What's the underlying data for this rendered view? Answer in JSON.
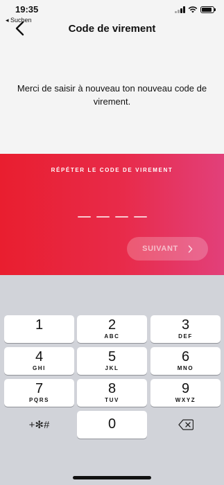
{
  "status": {
    "time": "19:35",
    "back_app_label": "◂ Suchen",
    "battery_level": 0.85
  },
  "header": {
    "title": "Code de virement"
  },
  "message": "Merci de saisir à nouveau ton nouveau code de virement.",
  "panel": {
    "label": "RÉPÉTER LE CODE DE VIREMENT",
    "pin_length": 4,
    "next_label": "SUIVANT"
  },
  "keypad": {
    "keys": [
      {
        "digit": "1",
        "letters": ""
      },
      {
        "digit": "2",
        "letters": "ABC"
      },
      {
        "digit": "3",
        "letters": "DEF"
      },
      {
        "digit": "4",
        "letters": "GHI"
      },
      {
        "digit": "5",
        "letters": "JKL"
      },
      {
        "digit": "6",
        "letters": "MNO"
      },
      {
        "digit": "7",
        "letters": "PQRS"
      },
      {
        "digit": "8",
        "letters": "TUV"
      },
      {
        "digit": "9",
        "letters": "WXYZ"
      }
    ],
    "symbols_label": "+✻#",
    "zero": "0"
  },
  "colors": {
    "gradient_start": "#e91e2f",
    "gradient_end": "#e2407a"
  }
}
